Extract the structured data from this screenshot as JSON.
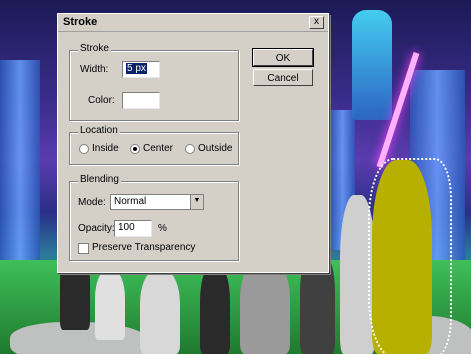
{
  "dialog": {
    "title": "Stroke",
    "close_glyph": "x",
    "ok_label": "OK",
    "cancel_label": "Cancel"
  },
  "stroke": {
    "legend": "Stroke",
    "width_label": "Width:",
    "width_value": "5 px",
    "color_label": "Color:"
  },
  "location": {
    "legend": "Location",
    "options": [
      "Inside",
      "Center",
      "Outside"
    ],
    "selected": "Center"
  },
  "blending": {
    "legend": "Blending",
    "mode_label": "Mode:",
    "mode_value": "Normal",
    "opacity_label": "Opacity:",
    "opacity_value": "100",
    "opacity_unit": "%",
    "preserve_label": "Preserve Transparency",
    "preserve_checked": false
  },
  "colors": {
    "stroke_color": "#ffffff",
    "dialog_bg": "#d4d0c8"
  }
}
